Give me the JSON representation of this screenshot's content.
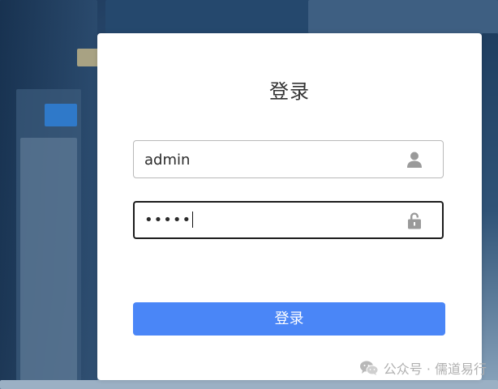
{
  "login": {
    "title": "登录",
    "username": {
      "value": "admin",
      "icon": "user-icon"
    },
    "password": {
      "masked_value": "•••••",
      "icon": "lock-icon"
    },
    "submit_label": "登录"
  },
  "watermark": {
    "text": "公众号 · 儒道易行",
    "icon": "wechat-icon"
  },
  "colors": {
    "accent": "#4a86f7",
    "card": "#ffffff"
  }
}
